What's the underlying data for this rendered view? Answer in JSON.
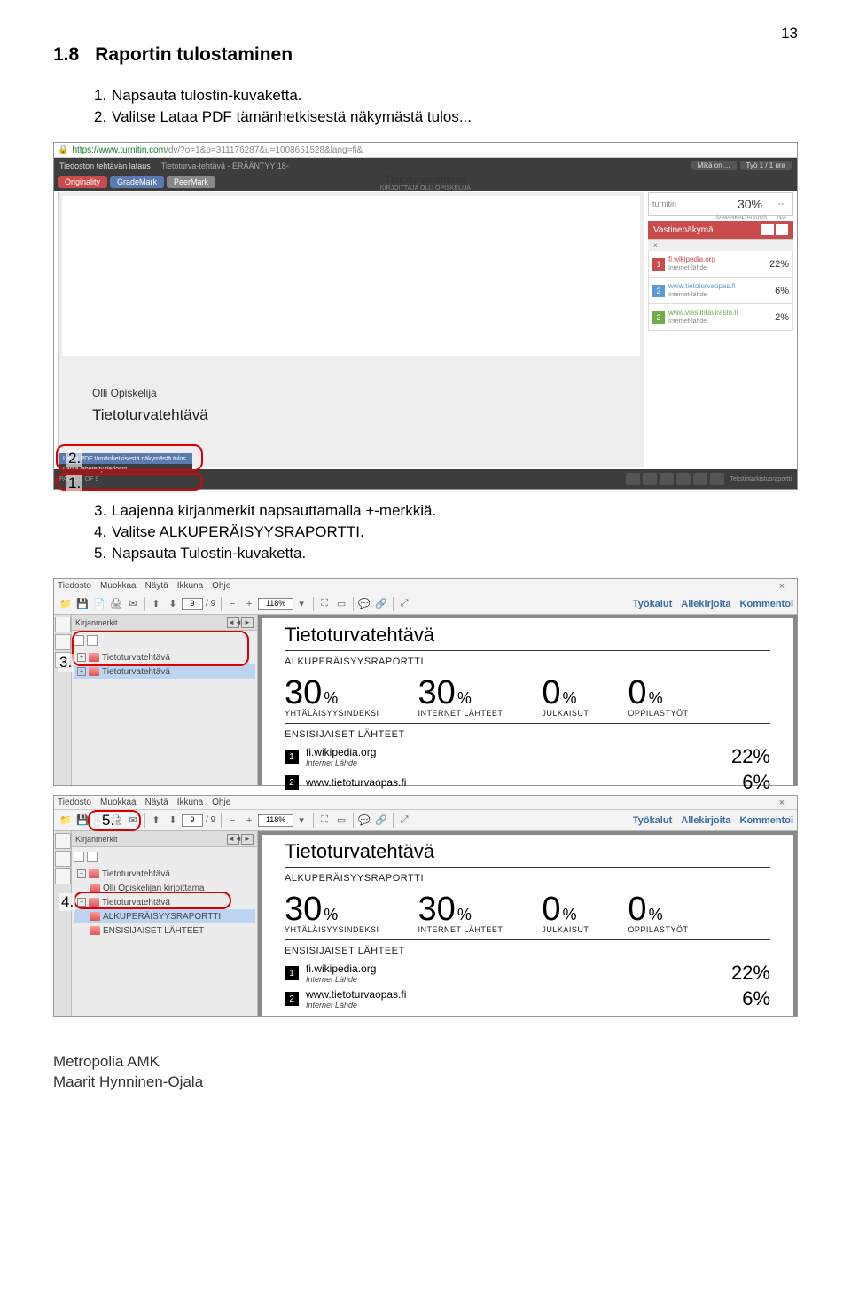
{
  "page_number": "13",
  "section_num": "1.8",
  "section_title": "Raportin tulostaminen",
  "steps_a": [
    {
      "n": "1.",
      "t": "Napsauta tulostin-kuvaketta."
    },
    {
      "n": "2.",
      "t": "Valitse Lataa PDF tämänhetkisestä näkymästä tulos..."
    }
  ],
  "steps_b": [
    {
      "n": "3.",
      "t": "Laajenna kirjanmerkit napsauttamalla +-merkkiä."
    },
    {
      "n": "4.",
      "t": "Valitse ALKUPERÄISYYSRAPORTTI."
    },
    {
      "n": "5.",
      "t": "Napsauta Tulostin-kuvaketta."
    }
  ],
  "screenshot1": {
    "url_host": "https://www.turnitin.com",
    "url_path": "/dv/?o=1&o=311176287&u=1008651528&lang=fi&",
    "bar_left1": "Tiedoston tehtävän lataus",
    "bar_left2": "Tietoturva-tehtävä - ERÄÄNTYY 18-",
    "bar_right1": "Mikä on ...",
    "bar_right2": "Työ 1 / 1 ura",
    "btn_originality": "Originality",
    "btn_grademark": "GradeMark",
    "btn_peermark": "PeerMark",
    "doc_title": "Tietoturvatehtävä",
    "doc_sub": "KIRJOITTAJA OLLI OPISKELIJA",
    "turnitin_logo": "turnitin",
    "sim_pct": "30%",
    "sim_dash": "--",
    "sim_l1": "SAMANKALTAISUUS",
    "sim_l2": "N/A",
    "match_title": "Vastinenäkymä",
    "sources": [
      {
        "site": "fi.wikipedia.org",
        "type": "Internet-lähde",
        "pct": "22%"
      },
      {
        "site": "www.tietoturvaopas.fi",
        "type": "Internet-lähde",
        "pct": "6%"
      },
      {
        "site": "www.viestintavirasto.fi",
        "type": "Internet-lähde",
        "pct": "2%"
      }
    ],
    "author_inpage": "Olli Opiskelija",
    "title_inpage": "Tietoturvatehtävä",
    "dl_row1": "Lataa PDF tämänhetkisestä näkymästä tulos",
    "dl_row2": "Lataa lähetetty tiedosto",
    "callout2": "2.",
    "callout1": "1."
  },
  "pdf_common": {
    "menu": [
      "Tiedosto",
      "Muokkaa",
      "Näytä",
      "Ikkuna",
      "Ohje"
    ],
    "page_cur": "9",
    "page_total": "/ 9",
    "zoom": "118%",
    "right_tools": "Työkalut",
    "right_sign": "Allekirjoita",
    "right_comment": "Kommentoi",
    "side_label": "Kirjanmerkit",
    "nav_prev": "◄◄",
    "nav_next": "►",
    "doc_title": "Tietoturvatehtävä",
    "report_label": "ALKUPERÄISYYSRAPORTTI",
    "primary_label": "ENSISIJAISET LÄHTEET",
    "metrics": [
      {
        "v": "30",
        "u": "%",
        "l": "YHTÄLÄISYYSINDEKSI"
      },
      {
        "v": "30",
        "u": "%",
        "l": "INTERNET LÄHTEET"
      },
      {
        "v": "0",
        "u": "%",
        "l": "JULKAISUT"
      },
      {
        "v": "0",
        "u": "%",
        "l": "OPPILASTYÖT"
      }
    ],
    "src1_site": "fi.wikipedia.org",
    "src1_type": "Internet Lähde",
    "src1_pct": "22%",
    "src2_site": "www.tietoturvaopas.fi",
    "src2_type": "Internet Lähde",
    "src2_pct": "6%"
  },
  "pdf1": {
    "bm1": "Tietoturvatehtävä",
    "bm2": "Tietoturvatehtävä",
    "callout": "3."
  },
  "pdf2": {
    "bm1": "Tietoturvatehtävä",
    "bm2": "Olli Opiskelijan kirjoittama",
    "bm3": "Tietoturvatehtävä",
    "bm4": "ALKUPERÄISYYSRAPORTTI",
    "bm5": "ENSISIJAISET LÄHTEET",
    "callout5": "5.",
    "callout4": "4."
  },
  "footer": {
    "l1": "Metropolia AMK",
    "l2": "Maarit Hynninen-Ojala"
  }
}
